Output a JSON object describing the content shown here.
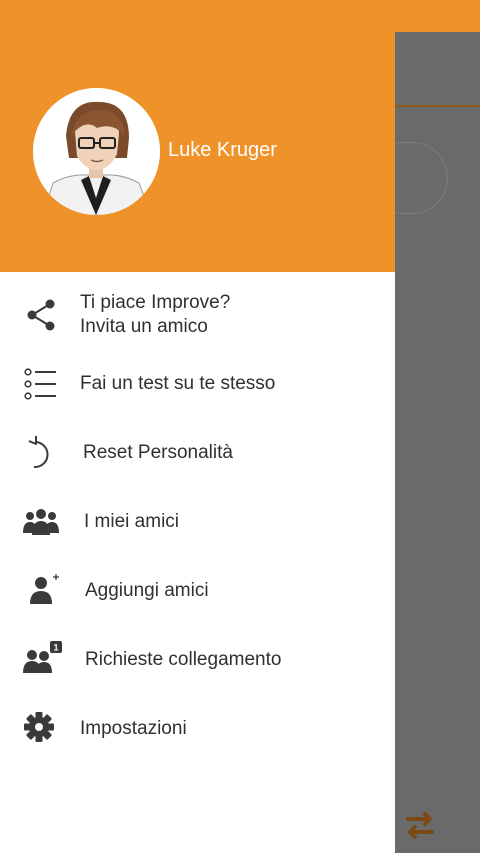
{
  "user": {
    "name": "Luke Kruger"
  },
  "menu": {
    "items": [
      {
        "line1": "Ti piace Improve?",
        "line2": "Invita un amico",
        "icon": "share-icon"
      },
      {
        "label": "Fai un test su te stesso",
        "icon": "list-icon"
      },
      {
        "label": "Reset Personalità",
        "icon": "reset-icon"
      },
      {
        "label": "I miei amici",
        "icon": "friends-icon"
      },
      {
        "label": "Aggiungi amici",
        "icon": "add-friend-icon"
      },
      {
        "label": "Richieste collegamento",
        "icon": "requests-icon",
        "badge": "1"
      },
      {
        "label": "Impostazioni",
        "icon": "gear-icon"
      }
    ]
  },
  "colors": {
    "accent": "#f0922a",
    "overlay": "#6a6a6a",
    "text": "#303030",
    "icon": "#3a3a3a"
  }
}
